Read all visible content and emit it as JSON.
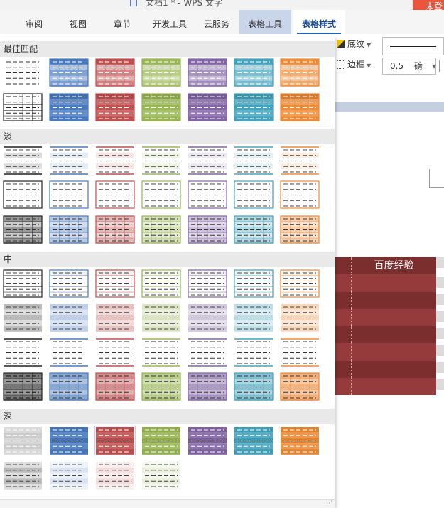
{
  "window": {
    "title": "文档1 * - WPS 文字",
    "sign_in": "未登"
  },
  "tabs": [
    {
      "label": "审阅",
      "state": "normal"
    },
    {
      "label": "视图",
      "state": "normal"
    },
    {
      "label": "章节",
      "state": "normal"
    },
    {
      "label": "开发工具",
      "state": "normal"
    },
    {
      "label": "云服务",
      "state": "normal"
    },
    {
      "label": "表格工具",
      "state": "tool"
    },
    {
      "label": "表格样式",
      "state": "active"
    }
  ],
  "ribbon": {
    "shading_label": "底纹",
    "border_label": "边框",
    "line_weight_value": "0.5",
    "line_weight_unit": "磅"
  },
  "colors": {
    "accent": "#2b62b8",
    "doc_table_header": "#7b2e2e",
    "doc_table_row_a": "#953b3b",
    "doc_table_row_b": "#7b2e2e"
  },
  "document": {
    "table_header_text": "百度经验"
  },
  "style_panel": {
    "palette": [
      "#8c8c8c",
      "#4a7abf",
      "#c05050",
      "#98b553",
      "#8165a4",
      "#44a3bc",
      "#ec8a36"
    ],
    "sections": [
      {
        "title": "最佳匹配",
        "rows": [
          {
            "variant": "best1",
            "colors": [
              0,
              1,
              2,
              3,
              4,
              5,
              6
            ]
          },
          {
            "variant": "best2",
            "colors": [
              0,
              1,
              2,
              3,
              4,
              5,
              6
            ]
          }
        ]
      },
      {
        "title": "淡",
        "rows": [
          {
            "variant": "light1",
            "colors": [
              0,
              1,
              2,
              3,
              4,
              5,
              6
            ]
          },
          {
            "variant": "light2",
            "colors": [
              0,
              1,
              2,
              3,
              4,
              5,
              6
            ]
          },
          {
            "variant": "light3",
            "colors": [
              0,
              1,
              2,
              3,
              4,
              5,
              6
            ]
          }
        ]
      },
      {
        "title": "中",
        "rows": [
          {
            "variant": "med1",
            "colors": [
              0,
              1,
              2,
              3,
              4,
              5,
              6
            ]
          },
          {
            "variant": "med2",
            "colors": [
              0,
              1,
              2,
              3,
              4,
              5,
              6
            ]
          },
          {
            "variant": "med3",
            "colors": [
              0,
              1,
              2,
              3,
              4,
              5,
              6
            ]
          },
          {
            "variant": "med4",
            "colors": [
              0,
              1,
              2,
              3,
              4,
              5,
              6
            ]
          }
        ]
      },
      {
        "title": "深",
        "rows": [
          {
            "variant": "dark1",
            "colors": [
              0,
              1,
              2,
              3,
              4,
              5,
              6
            ]
          },
          {
            "variant": "dark2",
            "colors": [
              0,
              1,
              2,
              3
            ]
          }
        ]
      }
    ],
    "selected_style": "dark1-2"
  }
}
